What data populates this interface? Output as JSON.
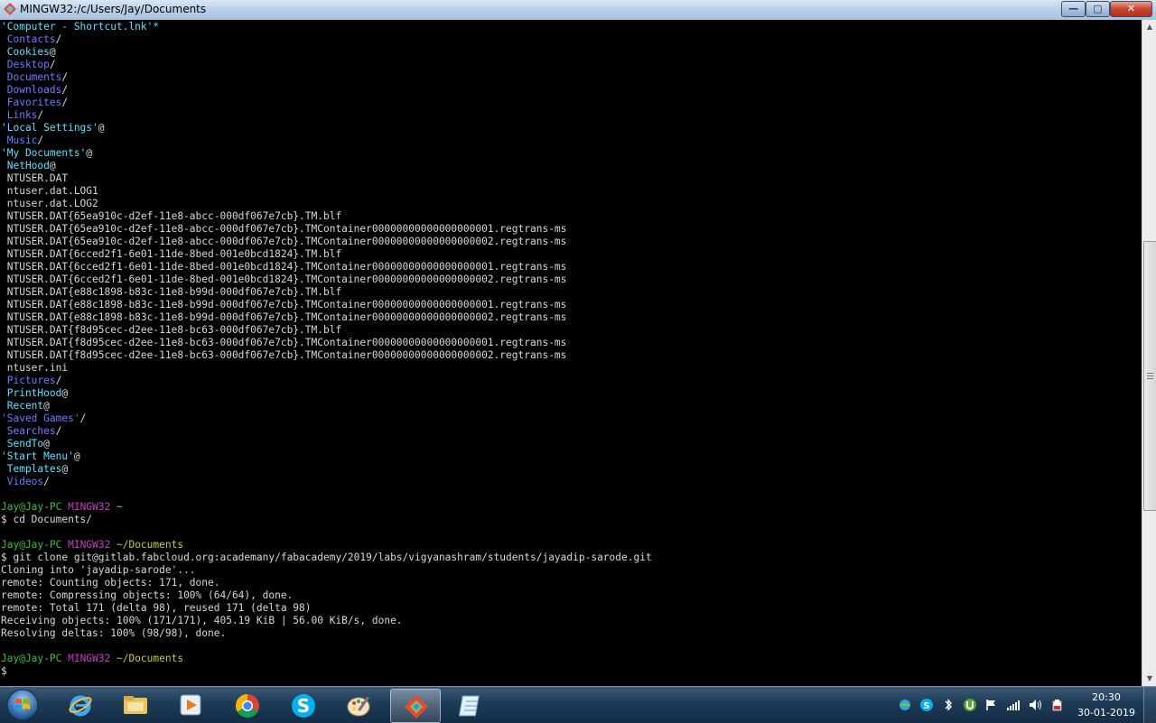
{
  "window": {
    "title": "MINGW32:/c/Users/Jay/Documents",
    "min_glyph": "—",
    "max_glyph": "▢",
    "close_glyph": "✕"
  },
  "colors": {
    "dir": "#6e7cff",
    "link": "#5fe2ff",
    "plain": "#d8d8d8",
    "prompt_user": "#3fbf3f",
    "prompt_host": "#c23fc2",
    "prompt_path": "#c8c83c"
  },
  "terminal": {
    "lines": [
      {
        "segments": [
          {
            "t": "'Computer - Shortcut.lnk'*",
            "c": "link"
          }
        ]
      },
      {
        "segments": [
          {
            "t": " Contacts",
            "c": "dir"
          },
          {
            "t": "/",
            "c": "plain"
          }
        ]
      },
      {
        "segments": [
          {
            "t": " Cookies",
            "c": "link"
          },
          {
            "t": "@",
            "c": "plain"
          }
        ]
      },
      {
        "segments": [
          {
            "t": " Desktop",
            "c": "dir"
          },
          {
            "t": "/",
            "c": "plain"
          }
        ]
      },
      {
        "segments": [
          {
            "t": " Documents",
            "c": "dir"
          },
          {
            "t": "/",
            "c": "plain"
          }
        ]
      },
      {
        "segments": [
          {
            "t": " Downloads",
            "c": "dir"
          },
          {
            "t": "/",
            "c": "plain"
          }
        ]
      },
      {
        "segments": [
          {
            "t": " Favorites",
            "c": "dir"
          },
          {
            "t": "/",
            "c": "plain"
          }
        ]
      },
      {
        "segments": [
          {
            "t": " Links",
            "c": "dir"
          },
          {
            "t": "/",
            "c": "plain"
          }
        ]
      },
      {
        "segments": [
          {
            "t": "'Local Settings'",
            "c": "link"
          },
          {
            "t": "@",
            "c": "plain"
          }
        ]
      },
      {
        "segments": [
          {
            "t": " Music",
            "c": "dir"
          },
          {
            "t": "/",
            "c": "plain"
          }
        ]
      },
      {
        "segments": [
          {
            "t": "'My Documents'",
            "c": "link"
          },
          {
            "t": "@",
            "c": "plain"
          }
        ]
      },
      {
        "segments": [
          {
            "t": " NetHood",
            "c": "link"
          },
          {
            "t": "@",
            "c": "plain"
          }
        ]
      },
      {
        "segments": [
          {
            "t": " NTUSER.DAT",
            "c": "plain"
          }
        ]
      },
      {
        "segments": [
          {
            "t": " ntuser.dat.LOG1",
            "c": "plain"
          }
        ]
      },
      {
        "segments": [
          {
            "t": " ntuser.dat.LOG2",
            "c": "plain"
          }
        ]
      },
      {
        "segments": [
          {
            "t": " NTUSER.DAT{65ea910c-d2ef-11e8-abcc-000df067e7cb}.TM.blf",
            "c": "plain"
          }
        ]
      },
      {
        "segments": [
          {
            "t": " NTUSER.DAT{65ea910c-d2ef-11e8-abcc-000df067e7cb}.TMContainer00000000000000000001.regtrans-ms",
            "c": "plain"
          }
        ]
      },
      {
        "segments": [
          {
            "t": " NTUSER.DAT{65ea910c-d2ef-11e8-abcc-000df067e7cb}.TMContainer00000000000000000002.regtrans-ms",
            "c": "plain"
          }
        ]
      },
      {
        "segments": [
          {
            "t": " NTUSER.DAT{6cced2f1-6e01-11de-8bed-001e0bcd1824}.TM.blf",
            "c": "plain"
          }
        ]
      },
      {
        "segments": [
          {
            "t": " NTUSER.DAT{6cced2f1-6e01-11de-8bed-001e0bcd1824}.TMContainer00000000000000000001.regtrans-ms",
            "c": "plain"
          }
        ]
      },
      {
        "segments": [
          {
            "t": " NTUSER.DAT{6cced2f1-6e01-11de-8bed-001e0bcd1824}.TMContainer00000000000000000002.regtrans-ms",
            "c": "plain"
          }
        ]
      },
      {
        "segments": [
          {
            "t": " NTUSER.DAT{e88c1898-b83c-11e8-b99d-000df067e7cb}.TM.blf",
            "c": "plain"
          }
        ]
      },
      {
        "segments": [
          {
            "t": " NTUSER.DAT{e88c1898-b83c-11e8-b99d-000df067e7cb}.TMContainer00000000000000000001.regtrans-ms",
            "c": "plain"
          }
        ]
      },
      {
        "segments": [
          {
            "t": " NTUSER.DAT{e88c1898-b83c-11e8-b99d-000df067e7cb}.TMContainer00000000000000000002.regtrans-ms",
            "c": "plain"
          }
        ]
      },
      {
        "segments": [
          {
            "t": " NTUSER.DAT{f8d95cec-d2ee-11e8-bc63-000df067e7cb}.TM.blf",
            "c": "plain"
          }
        ]
      },
      {
        "segments": [
          {
            "t": " NTUSER.DAT{f8d95cec-d2ee-11e8-bc63-000df067e7cb}.TMContainer00000000000000000001.regtrans-ms",
            "c": "plain"
          }
        ]
      },
      {
        "segments": [
          {
            "t": " NTUSER.DAT{f8d95cec-d2ee-11e8-bc63-000df067e7cb}.TMContainer00000000000000000002.regtrans-ms",
            "c": "plain"
          }
        ]
      },
      {
        "segments": [
          {
            "t": " ntuser.ini",
            "c": "plain"
          }
        ]
      },
      {
        "segments": [
          {
            "t": " Pictures",
            "c": "dir"
          },
          {
            "t": "/",
            "c": "plain"
          }
        ]
      },
      {
        "segments": [
          {
            "t": " PrintHood",
            "c": "link"
          },
          {
            "t": "@",
            "c": "plain"
          }
        ]
      },
      {
        "segments": [
          {
            "t": " Recent",
            "c": "link"
          },
          {
            "t": "@",
            "c": "plain"
          }
        ]
      },
      {
        "segments": [
          {
            "t": "'Saved Games'",
            "c": "dir"
          },
          {
            "t": "/",
            "c": "plain"
          }
        ]
      },
      {
        "segments": [
          {
            "t": " Searches",
            "c": "dir"
          },
          {
            "t": "/",
            "c": "plain"
          }
        ]
      },
      {
        "segments": [
          {
            "t": " SendTo",
            "c": "link"
          },
          {
            "t": "@",
            "c": "plain"
          }
        ]
      },
      {
        "segments": [
          {
            "t": "'Start Menu'",
            "c": "link"
          },
          {
            "t": "@",
            "c": "plain"
          }
        ]
      },
      {
        "segments": [
          {
            "t": " Templates",
            "c": "link"
          },
          {
            "t": "@",
            "c": "plain"
          }
        ]
      },
      {
        "segments": [
          {
            "t": " Videos",
            "c": "dir"
          },
          {
            "t": "/",
            "c": "plain"
          }
        ]
      },
      {
        "segments": []
      },
      {
        "segments": [
          {
            "t": "Jay@Jay-PC ",
            "c": "green"
          },
          {
            "t": "MINGW32 ",
            "c": "mag"
          },
          {
            "t": "~",
            "c": "yel"
          }
        ]
      },
      {
        "segments": [
          {
            "t": "$ cd Documents/",
            "c": "plain"
          }
        ]
      },
      {
        "segments": []
      },
      {
        "segments": [
          {
            "t": "Jay@Jay-PC ",
            "c": "green"
          },
          {
            "t": "MINGW32 ",
            "c": "mag"
          },
          {
            "t": "~/Documents",
            "c": "yel"
          }
        ]
      },
      {
        "segments": [
          {
            "t": "$ git clone git@gitlab.fabcloud.org:academany/fabacademy/2019/labs/vigyanashram/students/jayadip-sarode.git",
            "c": "plain"
          }
        ]
      },
      {
        "segments": [
          {
            "t": "Cloning into 'jayadip-sarode'...",
            "c": "plain"
          }
        ]
      },
      {
        "segments": [
          {
            "t": "remote: Counting objects: 171, done.",
            "c": "plain"
          }
        ]
      },
      {
        "segments": [
          {
            "t": "remote: Compressing objects: 100% (64/64), done.",
            "c": "plain"
          }
        ]
      },
      {
        "segments": [
          {
            "t": "remote: Total 171 (delta 98), reused 171 (delta 98)",
            "c": "plain"
          }
        ]
      },
      {
        "segments": [
          {
            "t": "Receiving objects: 100% (171/171), 405.19 KiB | 56.00 KiB/s, done.",
            "c": "plain"
          }
        ]
      },
      {
        "segments": [
          {
            "t": "Resolving deltas: 100% (98/98), done.",
            "c": "plain"
          }
        ]
      },
      {
        "segments": []
      },
      {
        "segments": [
          {
            "t": "Jay@Jay-PC ",
            "c": "green"
          },
          {
            "t": "MINGW32 ",
            "c": "mag"
          },
          {
            "t": "~/Documents",
            "c": "yel"
          }
        ]
      },
      {
        "segments": [
          {
            "t": "$",
            "c": "plain"
          }
        ]
      }
    ]
  },
  "scrollbar": {
    "position_fraction": 0.56,
    "visible_fraction": 0.42
  },
  "taskbar": {
    "items": [
      {
        "name": "internet-explorer",
        "icon": "ie-icon",
        "active": false
      },
      {
        "name": "windows-explorer",
        "icon": "folder-icon",
        "active": false
      },
      {
        "name": "media-player",
        "icon": "media-player-icon",
        "active": false
      },
      {
        "name": "chrome",
        "icon": "chrome-icon",
        "active": false
      },
      {
        "name": "skype",
        "icon": "skype-icon",
        "active": false
      },
      {
        "name": "paint",
        "icon": "paint-icon",
        "active": false
      },
      {
        "name": "git-bash",
        "icon": "git-icon",
        "active": true
      },
      {
        "name": "notepad",
        "icon": "notepad-icon",
        "active": false
      }
    ],
    "tray_icons": [
      "network-drive-icon",
      "skype-tray-icon",
      "bluetooth-icon",
      "utorrent-icon",
      "action-center-flag-icon",
      "signal-icon",
      "volume-icon",
      "power-icon"
    ],
    "clock": {
      "time": "20:30",
      "date": "30-01-2019"
    }
  }
}
